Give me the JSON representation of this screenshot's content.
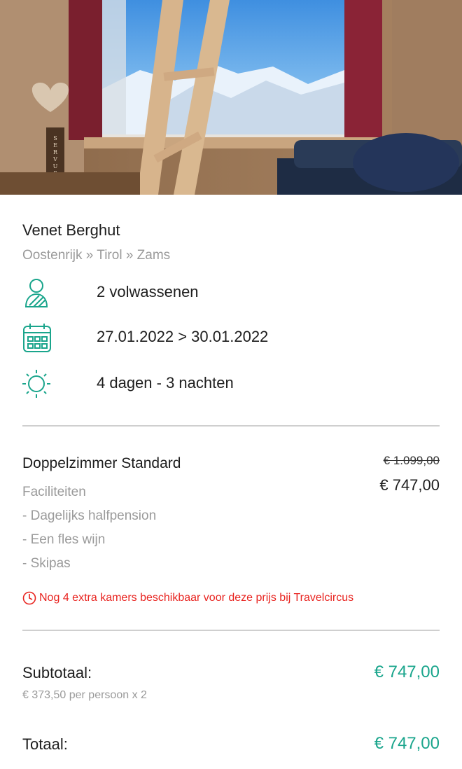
{
  "hotel": {
    "name": "Venet Berghut",
    "location": "Oostenrijk » Tirol » Zams"
  },
  "details": {
    "guests": "2 volwassenen",
    "dates": "27.01.2022 > 30.01.2022",
    "duration": "4 dagen - 3 nachten"
  },
  "room": {
    "name": "Doppelzimmer Standard",
    "old_price": "€ 1.099,00",
    "price": "€ 747,00",
    "facilities_title": "Faciliteiten",
    "facilities": [
      "- Dagelijks halfpension",
      "- Een fles wijn",
      "- Skipas"
    ],
    "alert_prefix": "Nog",
    "alert_count": "4",
    "alert_suffix": "extra kamers beschikbaar voor deze prijs bij Travelcircus"
  },
  "summary": {
    "subtotal_label": "Subtotaal:",
    "subtotal_value": "€ 747,00",
    "per_person": "€ 373,50 per persoon x 2",
    "total_label": "Totaal:",
    "total_value": "€ 747,00"
  },
  "hero_sign_text": "SERVUS",
  "colors": {
    "accent": "#1aa58c",
    "alert": "#e8231f",
    "muted": "#9a9a9a"
  },
  "icons": [
    "person-icon",
    "calendar-icon",
    "sun-icon",
    "clock-icon"
  ]
}
